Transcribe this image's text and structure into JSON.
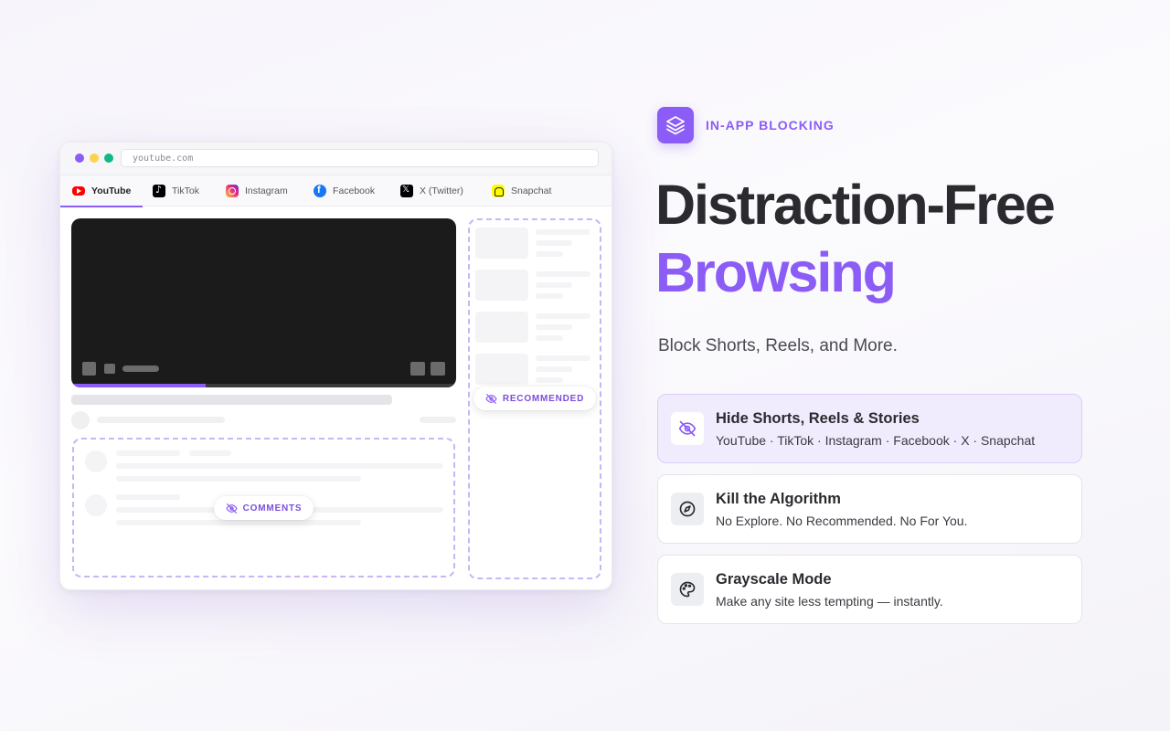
{
  "browser": {
    "url": "youtube.com",
    "tabs": [
      {
        "label": "YouTube",
        "icon": "youtube-icon",
        "active": true
      },
      {
        "label": "TikTok",
        "icon": "tiktok-icon"
      },
      {
        "label": "Instagram",
        "icon": "instagram-icon"
      },
      {
        "label": "Facebook",
        "icon": "facebook-icon"
      },
      {
        "label": "X (Twitter)",
        "icon": "x-twitter-icon"
      },
      {
        "label": "Snapchat",
        "icon": "snapchat-icon"
      }
    ],
    "video_progress": 0.35,
    "recommended_label": "RECOMMENDED",
    "comments_label": "COMMENTS"
  },
  "hero": {
    "eyebrow": "IN-APP BLOCKING",
    "eyebrow_icon": "layers-icon",
    "title_line1": "Distraction-Free",
    "title_line2": "Browsing",
    "subtitle": "Block Shorts, Reels, and More."
  },
  "features": [
    {
      "title": "Hide Shorts, Reels & Stories",
      "desc": "YouTube · TikTok · Instagram · Facebook · X · Snapchat",
      "icon": "eye-off-icon",
      "active": true
    },
    {
      "title": "Kill the Algorithm",
      "desc": "No Explore. No Recommended. No For You.",
      "icon": "compass-icon"
    },
    {
      "title": "Grayscale Mode",
      "desc": "Make any site less tempting — instantly.",
      "icon": "palette-icon"
    }
  ],
  "colors": {
    "accent": "#8b5cf6",
    "dashed_border": "#c9b6f4",
    "active_card_bg": "#f1ecfd"
  }
}
